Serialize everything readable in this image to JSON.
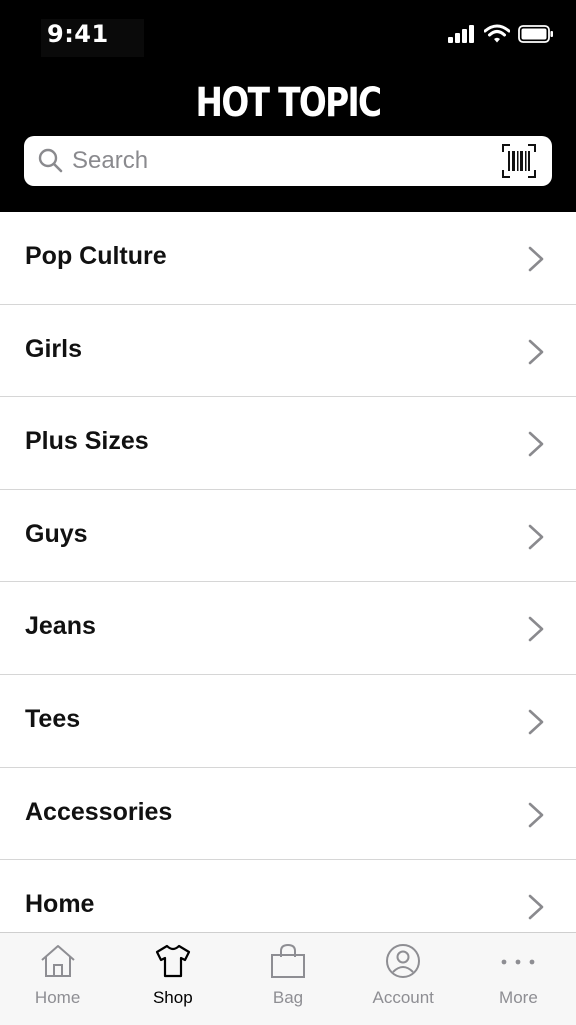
{
  "status_bar": {
    "time": "9:41"
  },
  "header": {
    "logo": "HOT TOPIC"
  },
  "search": {
    "placeholder": "Search"
  },
  "categories": [
    {
      "label": "Pop Culture"
    },
    {
      "label": "Girls"
    },
    {
      "label": "Plus Sizes"
    },
    {
      "label": "Guys"
    },
    {
      "label": "Jeans"
    },
    {
      "label": "Tees"
    },
    {
      "label": "Accessories"
    },
    {
      "label": "Home"
    }
  ],
  "tab_bar": {
    "active": "Shop",
    "items": [
      {
        "label": "Home",
        "icon": "house-icon"
      },
      {
        "label": "Shop",
        "icon": "tshirt-icon"
      },
      {
        "label": "Bag",
        "icon": "bag-icon"
      },
      {
        "label": "Account",
        "icon": "person-icon"
      },
      {
        "label": "More",
        "icon": "ellipsis-icon"
      }
    ]
  },
  "colors": {
    "header_bg": "#000000",
    "active_tab": "#000000",
    "inactive_tab": "#8e8e93"
  }
}
